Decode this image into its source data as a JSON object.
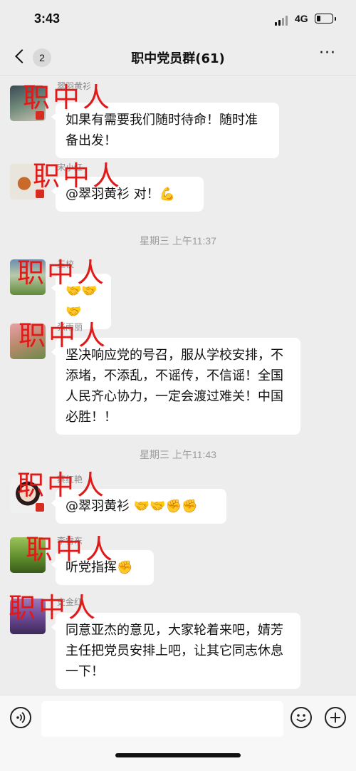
{
  "status_bar": {
    "time": "3:43",
    "network": "4G"
  },
  "header": {
    "back_badge": "2",
    "title": "职中党员群(61)",
    "more_icon": "···"
  },
  "watermark": "职中人",
  "messages": [
    {
      "sender": "翠羽黄衫",
      "text": "如果有需要我们随时待命！随时准备出发！"
    },
    {
      "sender": "宋小红",
      "text": "@翠羽黄衫 对！💪"
    },
    {
      "sender": "王校",
      "text": "🤝🤝🤝"
    },
    {
      "sender": "张雨丽",
      "text": "坚决响应党的号召，服从学校安排，不添堵，不添乱，不谣传，不信谣！全国人民齐心协力，一定会渡过难关！中国必胜！！"
    },
    {
      "sender": "蔡红艳",
      "text": "@翠羽黄衫 🤝🤝✊✊"
    },
    {
      "sender": "李雪东",
      "text": "听党指挥✊"
    },
    {
      "sender": "史金红",
      "text": "同意亚杰的意见，大家轮着来吧，婧芳主任把党员安排上吧，让其它同志休息一下！"
    }
  ],
  "timestamps": [
    "星期三 上午11:37",
    "星期三 上午11:43"
  ],
  "input_bar": {
    "voice_icon": "voice-icon",
    "emoji_icon": "emoji-icon",
    "plus_icon": "plus-icon",
    "placeholder": ""
  }
}
